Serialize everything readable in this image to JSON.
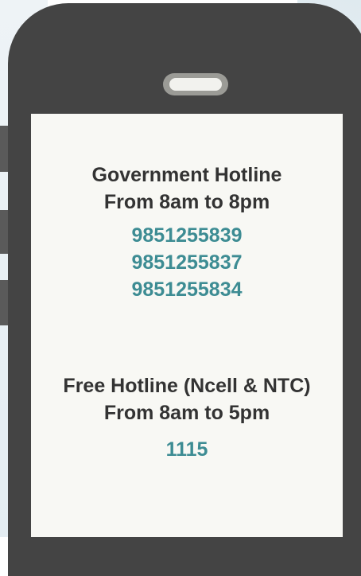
{
  "government": {
    "title": "Government Hotline",
    "hours": "From 8am to 8pm",
    "numbers": [
      "9851255839",
      "9851255837",
      "9851255834"
    ]
  },
  "free": {
    "title": "Free Hotline (Ncell & NTC)",
    "hours": "From 8am to 5pm",
    "number": "1115"
  },
  "colors": {
    "accent": "#3d8c93",
    "phone_body": "#444444",
    "screen": "#f8f8f4"
  }
}
